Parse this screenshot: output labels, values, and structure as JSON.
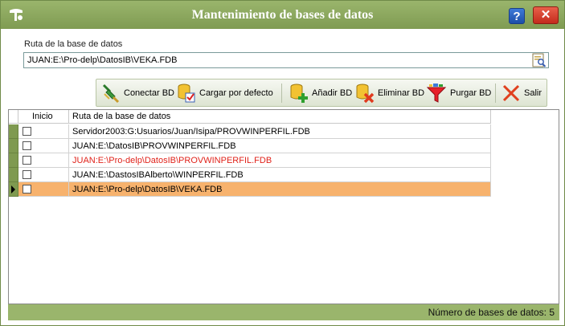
{
  "window": {
    "title": "Mantenimiento de bases de datos",
    "help_label": "?",
    "close_label": "✕"
  },
  "path_field": {
    "label": "Ruta de la base de datos",
    "value": "JUAN:E:\\Pro-delp\\DatosIB\\VEKA.FDB"
  },
  "toolbar": {
    "connect": "Conectar BD",
    "load_default": "Cargar por defecto",
    "add": "Añadir BD",
    "delete": "Eliminar BD",
    "purge": "Purgar BD",
    "exit": "Salir"
  },
  "grid": {
    "columns": [
      "Inicio",
      "Ruta de la base de datos"
    ],
    "rows": [
      {
        "start": false,
        "path": "Servidor2003:G:Usuarios/Juan/Isipa/PROVWINPERFIL.FDB",
        "color": "#000000",
        "selected": false
      },
      {
        "start": false,
        "path": "JUAN:E:\\DatosIB\\PROVWINPERFIL.FDB",
        "color": "#000000",
        "selected": false
      },
      {
        "start": false,
        "path": "JUAN:E:\\Pro-delp\\DatosIB\\PROVWINPERFIL.FDB",
        "color": "#e0231b",
        "selected": false
      },
      {
        "start": false,
        "path": "JUAN:E:\\DastosIBAlberto\\WINPERFIL.FDB",
        "color": "#000000",
        "selected": false
      },
      {
        "start": false,
        "path": "JUAN:E:\\Pro-delp\\DatosIB\\VEKA.FDB",
        "color": "#000000",
        "selected": true
      }
    ],
    "selected_color": "#f7b26d"
  },
  "status": {
    "text": "Número de bases de datos: 5"
  }
}
